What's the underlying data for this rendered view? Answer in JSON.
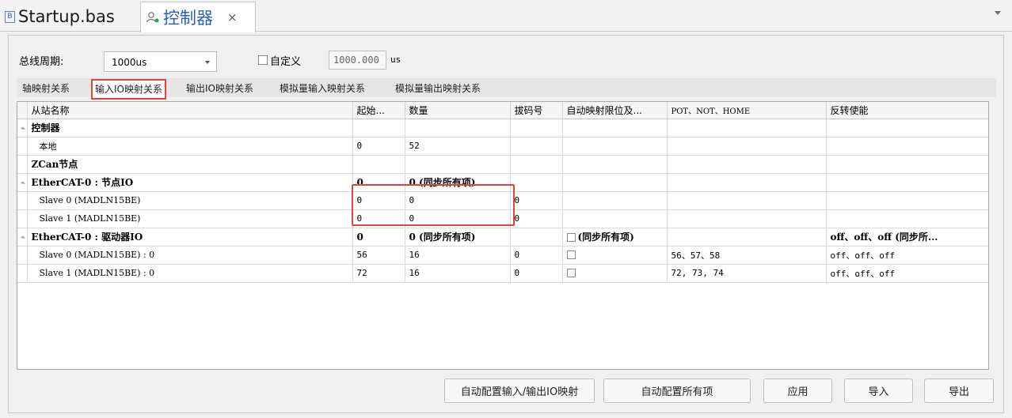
{
  "tabs": [
    {
      "label": "Startup.bas",
      "icon": "file-icon"
    },
    {
      "label": "控制器",
      "icon": "controller-icon",
      "close": "×"
    }
  ],
  "bus_period": {
    "label": "总线周期:",
    "value": "1000us"
  },
  "custom": {
    "label": "自定义",
    "value": "1000.000",
    "unit": "us"
  },
  "subtabs": [
    "轴映射关系",
    "输入IO映射关系",
    "输出IO映射关系",
    "模拟量输入映射关系",
    "模拟量输出映射关系"
  ],
  "grid": {
    "columns": [
      "从站名称",
      "起始...",
      "数量",
      "拔码号",
      "自动映射限位及...",
      "POT、NOT、HOME",
      "反转使能"
    ],
    "rows": [
      {
        "group": true,
        "expand": true,
        "name": "控制器",
        "start": "",
        "count": "",
        "dial": "",
        "auto": "",
        "pnh": "",
        "inv": ""
      },
      {
        "group": false,
        "name": "本地",
        "start": "0",
        "count": "52",
        "dial": "",
        "auto": "",
        "pnh": "",
        "inv": ""
      },
      {
        "group": true,
        "expand": false,
        "name": "ZCan节点",
        "start": "",
        "count": "",
        "dial": "",
        "auto": "",
        "pnh": "",
        "inv": ""
      },
      {
        "group": true,
        "expand": true,
        "name": "EtherCAT-0 : 节点IO",
        "start": "0",
        "count": "0 (同步所有项)",
        "dial": "",
        "auto": "",
        "pnh": "",
        "inv": ""
      },
      {
        "group": false,
        "name": "Slave 0 (MADLN15BE)",
        "start": "0",
        "count": "0",
        "dial": "0",
        "auto": "",
        "pnh": "",
        "inv": ""
      },
      {
        "group": false,
        "name": "Slave 1 (MADLN15BE)",
        "start": "0",
        "count": "0",
        "dial": "0",
        "auto": "",
        "pnh": "",
        "inv": ""
      },
      {
        "group": true,
        "expand": true,
        "name": "EtherCAT-0 : 驱动器IO",
        "start": "0",
        "count": "0 (同步所有项)",
        "dial": "",
        "auto": "(同步所有项)",
        "autocb": true,
        "pnh": "",
        "inv": "off、off、off (同步所..."
      },
      {
        "group": false,
        "name": "Slave 0 (MADLN15BE) : 0",
        "start": "56",
        "count": "16",
        "dial": "0",
        "auto": "",
        "autocb": true,
        "pnh": "56、57、58",
        "inv": "off、off、off"
      },
      {
        "group": false,
        "name": "Slave 1 (MADLN15BE) : 0",
        "start": "72",
        "count": "16",
        "dial": "0",
        "auto": "",
        "autocb": true,
        "pnh": "72, 73, 74",
        "inv": "off、off、off"
      }
    ]
  },
  "buttons": {
    "auto_io": "自动配置输入/输出IO映射",
    "auto_all": "自动配置所有项",
    "apply": "应用",
    "import": "导入",
    "export": "导出"
  },
  "colors": {
    "highlight": "#e0443b",
    "tab_active": "#2a5fb0"
  }
}
